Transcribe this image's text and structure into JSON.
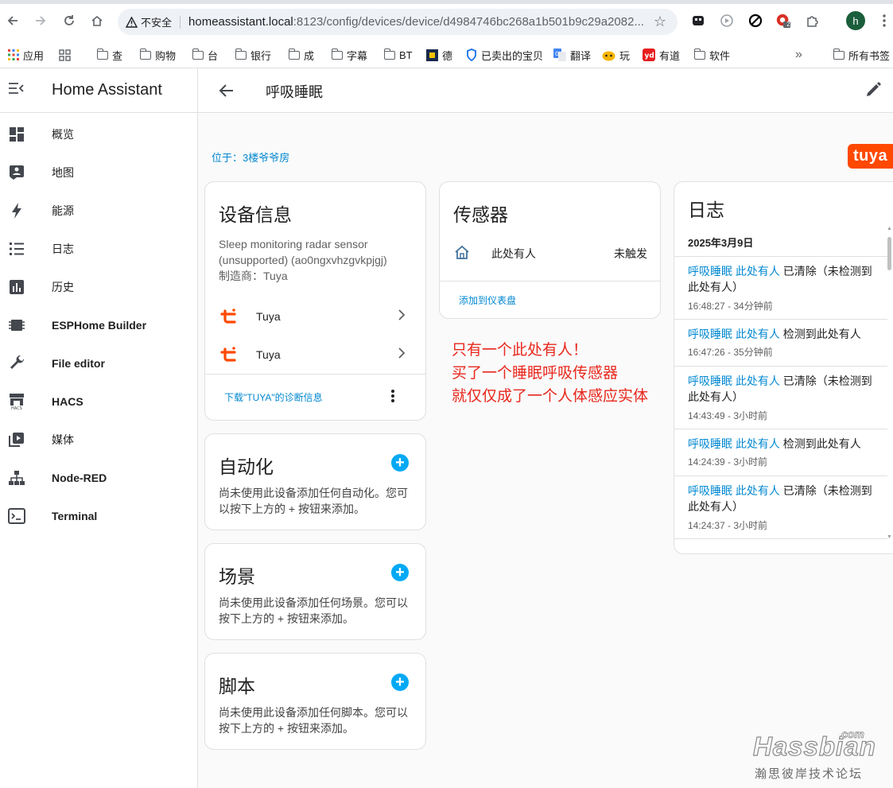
{
  "browser": {
    "insecure_label": "不安全",
    "url_host": "homeassistant.local",
    "url_path": ":8123/config/devices/device/d4984746bc268a1b501b9c29a2082...",
    "ext_badge": "2",
    "profile_initial": "h",
    "bookmarks": [
      "应用",
      "查",
      "购物",
      "台",
      "银行",
      "成",
      "字幕",
      "BT",
      "德",
      "已卖出的宝贝",
      "翻译",
      "玩",
      "有道",
      "软件"
    ],
    "bookmarks_more": "»",
    "all_bookmarks": "所有书签"
  },
  "sidebar": {
    "title": "Home Assistant",
    "items": [
      {
        "label": "概览",
        "icon": "dashboard-icon"
      },
      {
        "label": "地图",
        "icon": "map-icon"
      },
      {
        "label": "能源",
        "icon": "lightning-icon"
      },
      {
        "label": "日志",
        "icon": "list-icon"
      },
      {
        "label": "历史",
        "icon": "chart-icon"
      },
      {
        "label": "ESPHome Builder",
        "icon": "chip-icon"
      },
      {
        "label": "File editor",
        "icon": "wrench-icon"
      },
      {
        "label": "HACS",
        "icon": "store-icon"
      },
      {
        "label": "媒体",
        "icon": "media-icon"
      },
      {
        "label": "Node-RED",
        "icon": "sitemap-icon"
      },
      {
        "label": "Terminal",
        "icon": "terminal-icon"
      }
    ]
  },
  "header": {
    "title": "呼吸睡眠"
  },
  "area": {
    "label": "位于：3楼爷爷房"
  },
  "brand": {
    "logo_text": "tuya",
    "color": "#ff4800"
  },
  "device_info": {
    "title": "设备信息",
    "model": "Sleep monitoring radar sensor (unsupported) (ao0ngxvhzgvkpjgj)",
    "manufacturer": "制造商：Tuya",
    "integrations": [
      "Tuya",
      "Tuya"
    ],
    "download_link": "下载\"TUYA\"的诊断信息"
  },
  "automation": {
    "title": "自动化",
    "text": "尚未使用此设备添加任何自动化。您可以按下上方的 + 按钮来添加。"
  },
  "scene": {
    "title": "场景",
    "text": "尚未使用此设备添加任何场景。您可以按下上方的 + 按钮来添加。"
  },
  "script": {
    "title": "脚本",
    "text": "尚未使用此设备添加任何脚本。您可以按下上方的 + 按钮来添加。"
  },
  "sensors": {
    "title": "传感器",
    "entity_name": "此处有人",
    "entity_state": "未触发",
    "add_to_dashboard": "添加到仪表盘"
  },
  "annotation": [
    "只有一个此处有人！",
    "买了一个睡眠呼吸传感器",
    "就仅仅成了一个人体感应实体"
  ],
  "logbook": {
    "title": "日志",
    "date": "2025年3月9日",
    "entries": [
      {
        "entity": "呼吸睡眠 此处有人",
        "action": "已清除（未检测到此处有人）",
        "time": "16:48:27 - 34分钟前"
      },
      {
        "entity": "呼吸睡眠 此处有人",
        "action": "检测到此处有人",
        "time": "16:47:26 - 35分钟前"
      },
      {
        "entity": "呼吸睡眠 此处有人",
        "action": "已清除（未检测到此处有人）",
        "time": "14:43:49 - 3小时前"
      },
      {
        "entity": "呼吸睡眠 此处有人",
        "action": "检测到此处有人",
        "time": "14:24:39 - 3小时前"
      },
      {
        "entity": "呼吸睡眠 此处有人",
        "action": "已清除（未检测到此处有人）",
        "time": "14:24:37 - 3小时前"
      }
    ]
  },
  "watermark": {
    "brand": "Hassbian",
    "suffix": "com",
    "tagline": "瀚思彼岸技术论坛"
  },
  "colors": {
    "accent": "#03a9f4",
    "link": "#0288d1",
    "annotation": "#e8281d"
  }
}
